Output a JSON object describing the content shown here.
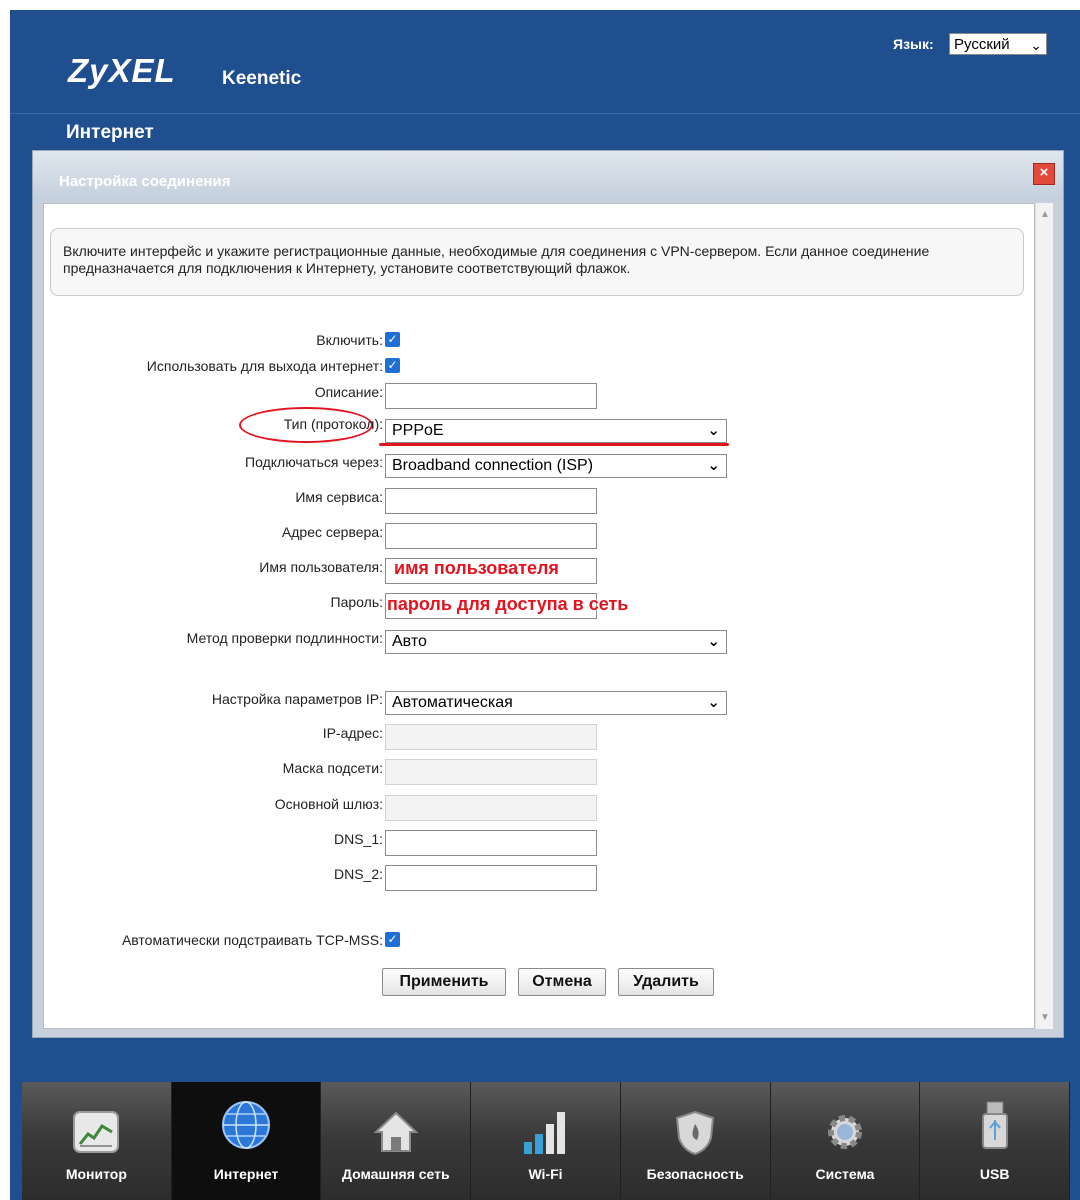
{
  "header": {
    "logo": "ZyXEL",
    "product": "Keenetic",
    "language_label": "Язык:",
    "language_value": "Русский",
    "section": "Интернет"
  },
  "dialog": {
    "title": "Настройка соединения",
    "close": "×",
    "info": "Включите интерфейс и укажите регистрационные данные, необходимые для соединения с VPN-сервером. Если данное соединение предназначается для подключения к Интернету, установите соответствующий флажок."
  },
  "form": {
    "enable_label": "Включить:",
    "enable_checked": true,
    "use_internet_label": "Использовать для выхода интернет:",
    "use_internet_checked": true,
    "description_label": "Описание:",
    "description_value": "",
    "type_label": "Тип (протокол):",
    "type_value": "PPPoE",
    "connect_via_label": "Подключаться через:",
    "connect_via_value": "Broadband connection (ISP)",
    "service_name_label": "Имя сервиса:",
    "service_name_value": "",
    "server_address_label": "Адрес сервера:",
    "server_address_value": "",
    "username_label": "Имя пользователя:",
    "username_annotation": "имя пользователя",
    "password_label": "Пароль:",
    "password_annotation": "пароль для доступа в сеть",
    "auth_method_label": "Метод проверки подлинности:",
    "auth_method_value": "Авто",
    "ip_settings_label": "Настройка параметров IP:",
    "ip_settings_value": "Автоматическая",
    "ip_address_label": "IP-адрес:",
    "subnet_mask_label": "Маска подсети:",
    "gateway_label": "Основной шлюз:",
    "dns1_label": "DNS_1:",
    "dns2_label": "DNS_2:",
    "tcp_mss_label": "Автоматически подстраивать TCP-MSS:",
    "tcp_mss_checked": true,
    "check_glyph": "✓"
  },
  "buttons": {
    "apply": "Применить",
    "cancel": "Отмена",
    "delete": "Удалить"
  },
  "nav": [
    {
      "label": "Монитор",
      "icon": "monitor-chart-icon",
      "active": false
    },
    {
      "label": "Интернет",
      "icon": "globe-icon",
      "active": true
    },
    {
      "label": "Домашняя сеть",
      "icon": "home-icon",
      "active": false
    },
    {
      "label": "Wi-Fi",
      "icon": "signal-bars-icon",
      "active": false
    },
    {
      "label": "Безопасность",
      "icon": "shield-icon",
      "active": false
    },
    {
      "label": "Система",
      "icon": "gear-icon",
      "active": false
    },
    {
      "label": "USB",
      "icon": "usb-drive-icon",
      "active": false
    }
  ],
  "colors": {
    "header_bg": "#1f4f8f",
    "annotation": "#e3141f",
    "checkbox": "#1f6fd6"
  }
}
